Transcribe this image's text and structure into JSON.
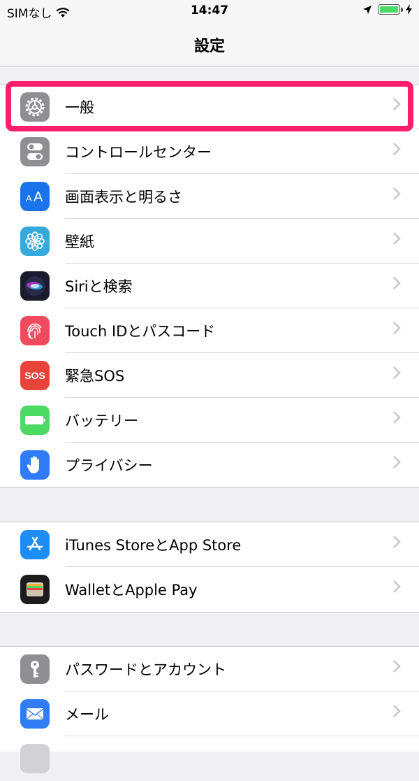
{
  "status_bar": {
    "carrier": "SIMなし",
    "time": "14:47"
  },
  "nav": {
    "title": "設定"
  },
  "groups": [
    {
      "items": [
        {
          "label": "一般",
          "icon": "gear-icon",
          "color": "#8e8e93"
        },
        {
          "label": "コントロールセンター",
          "icon": "toggles-icon",
          "color": "#8e8e93"
        },
        {
          "label": "画面表示と明るさ",
          "icon": "text-size-icon",
          "color": "#1a73e8"
        },
        {
          "label": "壁紙",
          "icon": "flower-icon",
          "color": "#36aadc"
        },
        {
          "label": "Siriと検索",
          "icon": "siri-icon",
          "color": "#1b1b2f"
        },
        {
          "label": "Touch IDとパスコード",
          "icon": "fingerprint-icon",
          "color": "#ef4a5e"
        },
        {
          "label": "緊急SOS",
          "icon": "sos-icon",
          "color": "#e8443a",
          "icon_text": "SOS"
        },
        {
          "label": "バッテリー",
          "icon": "battery-icon",
          "color": "#4cd964"
        },
        {
          "label": "プライバシー",
          "icon": "hand-icon",
          "color": "#2f7cf6"
        }
      ]
    },
    {
      "items": [
        {
          "label": "iTunes StoreとApp Store",
          "icon": "app-store-icon",
          "color": "#1e8cf5"
        },
        {
          "label": "WalletとApple Pay",
          "icon": "wallet-icon",
          "color": "#1c1c1e"
        }
      ]
    },
    {
      "items": [
        {
          "label": "パスワードとアカウント",
          "icon": "key-icon",
          "color": "#8e8e93"
        },
        {
          "label": "メール",
          "icon": "mail-icon",
          "color": "#2f7cf6"
        }
      ]
    }
  ],
  "highlight_color": "#ff1e6c"
}
